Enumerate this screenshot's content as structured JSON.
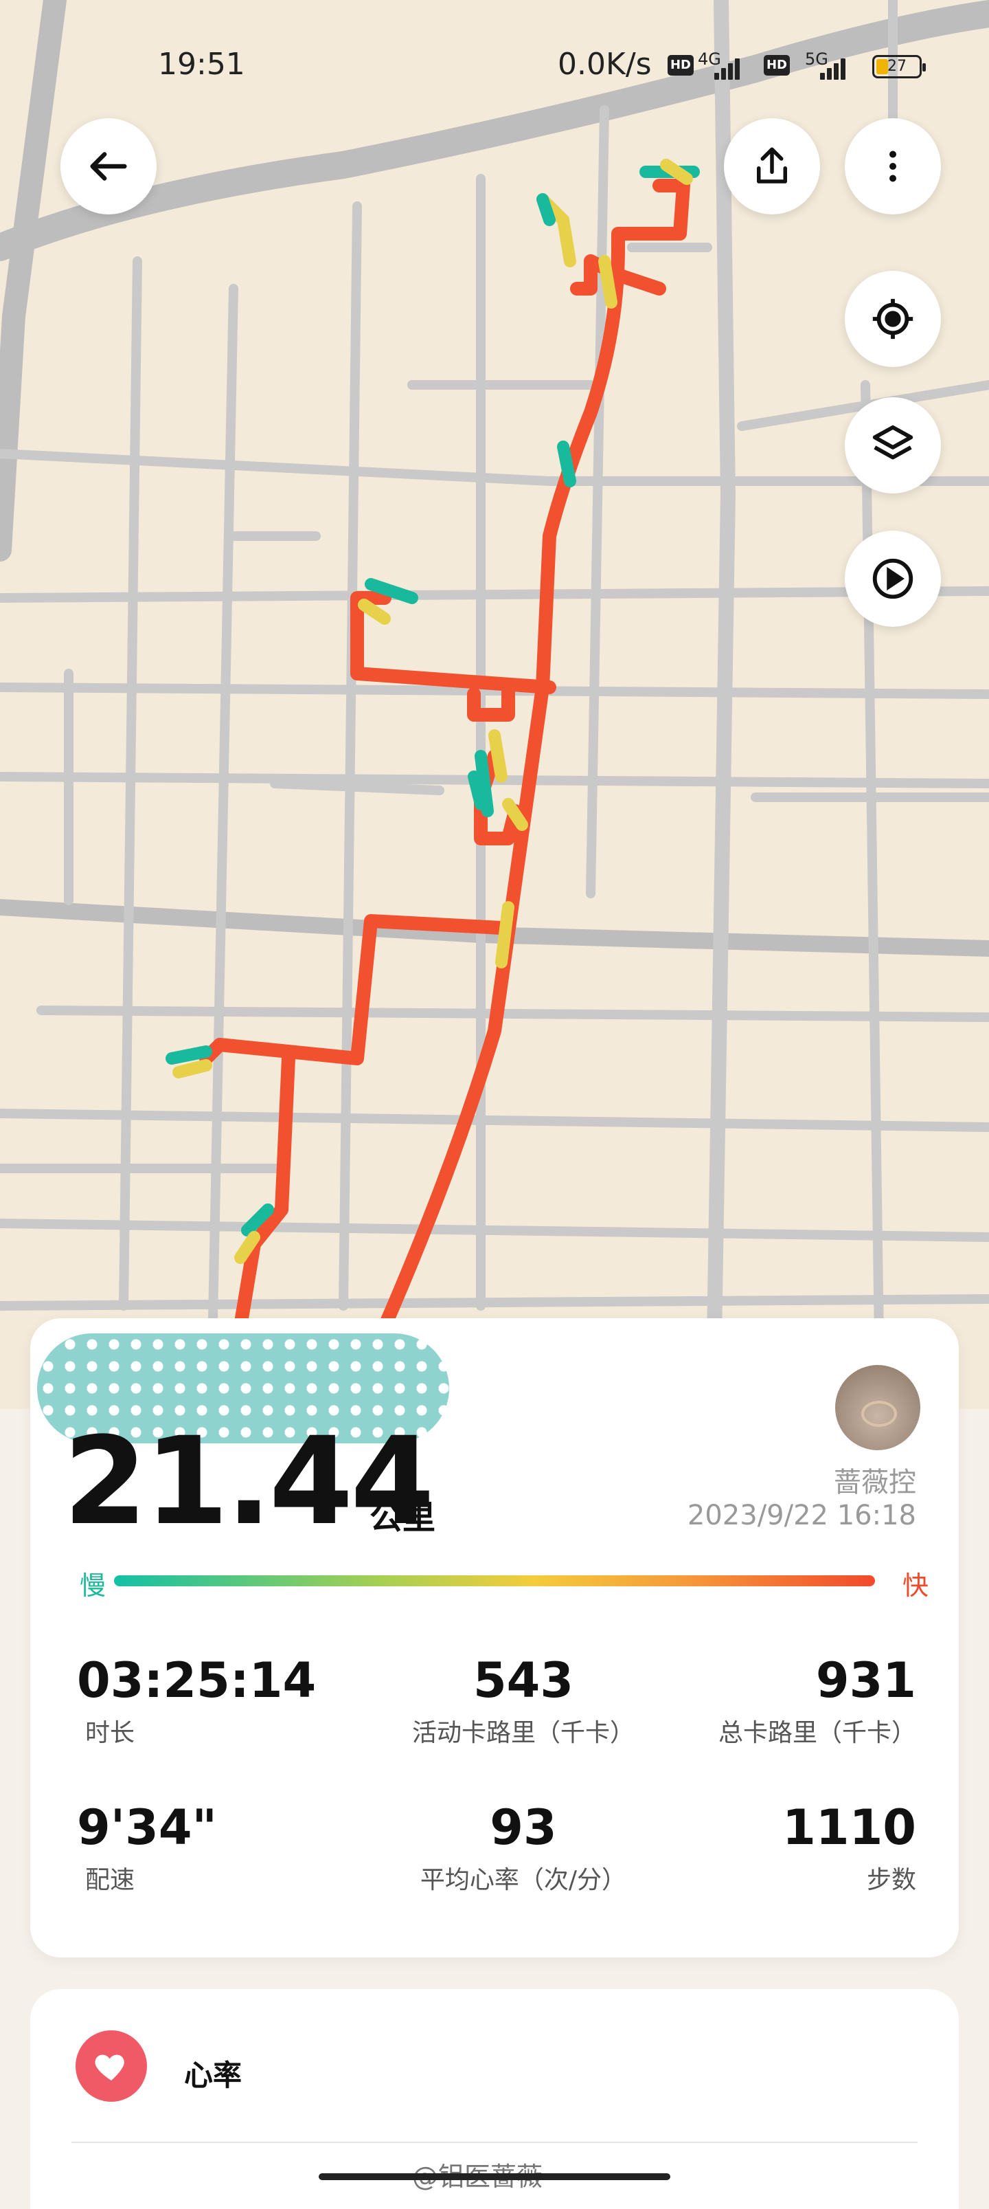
{
  "status_bar": {
    "time": "19:51",
    "net_speed": "0.0K/s",
    "hd_label": "HD",
    "sim1_type": "4G",
    "sim2_type": "5G",
    "battery": "27"
  },
  "map_icons": {
    "back": "arrow-left-icon",
    "share": "share-icon",
    "more": "more-vertical-icon",
    "locate": "crosshair-icon",
    "layers": "layers-icon",
    "play": "play-icon"
  },
  "summary": {
    "distance": "21.44",
    "distance_unit": "公里",
    "user_name": "蔷薇控",
    "datetime": "2023/9/22 16:18",
    "pace_slow_label": "慢",
    "pace_fast_label": "快"
  },
  "stats": [
    {
      "value": "03:25:14",
      "label": "时长"
    },
    {
      "value": "543",
      "label": "活动卡路里（千卡）"
    },
    {
      "value": "931",
      "label": "总卡路里（千卡）"
    },
    {
      "value": "9'34\"",
      "label": "配速"
    },
    {
      "value": "93",
      "label": "平均心率（次/分）"
    },
    {
      "value": "1110",
      "label": "步数"
    }
  ],
  "heart_rate_section": {
    "title": "心率",
    "icon": "heart-icon"
  },
  "watermark": "@铝医蔷薇",
  "colors": {
    "route": "#f2512f",
    "slow": "#14c0a6",
    "fast": "#f24a2c",
    "heart": "#f05a66"
  }
}
